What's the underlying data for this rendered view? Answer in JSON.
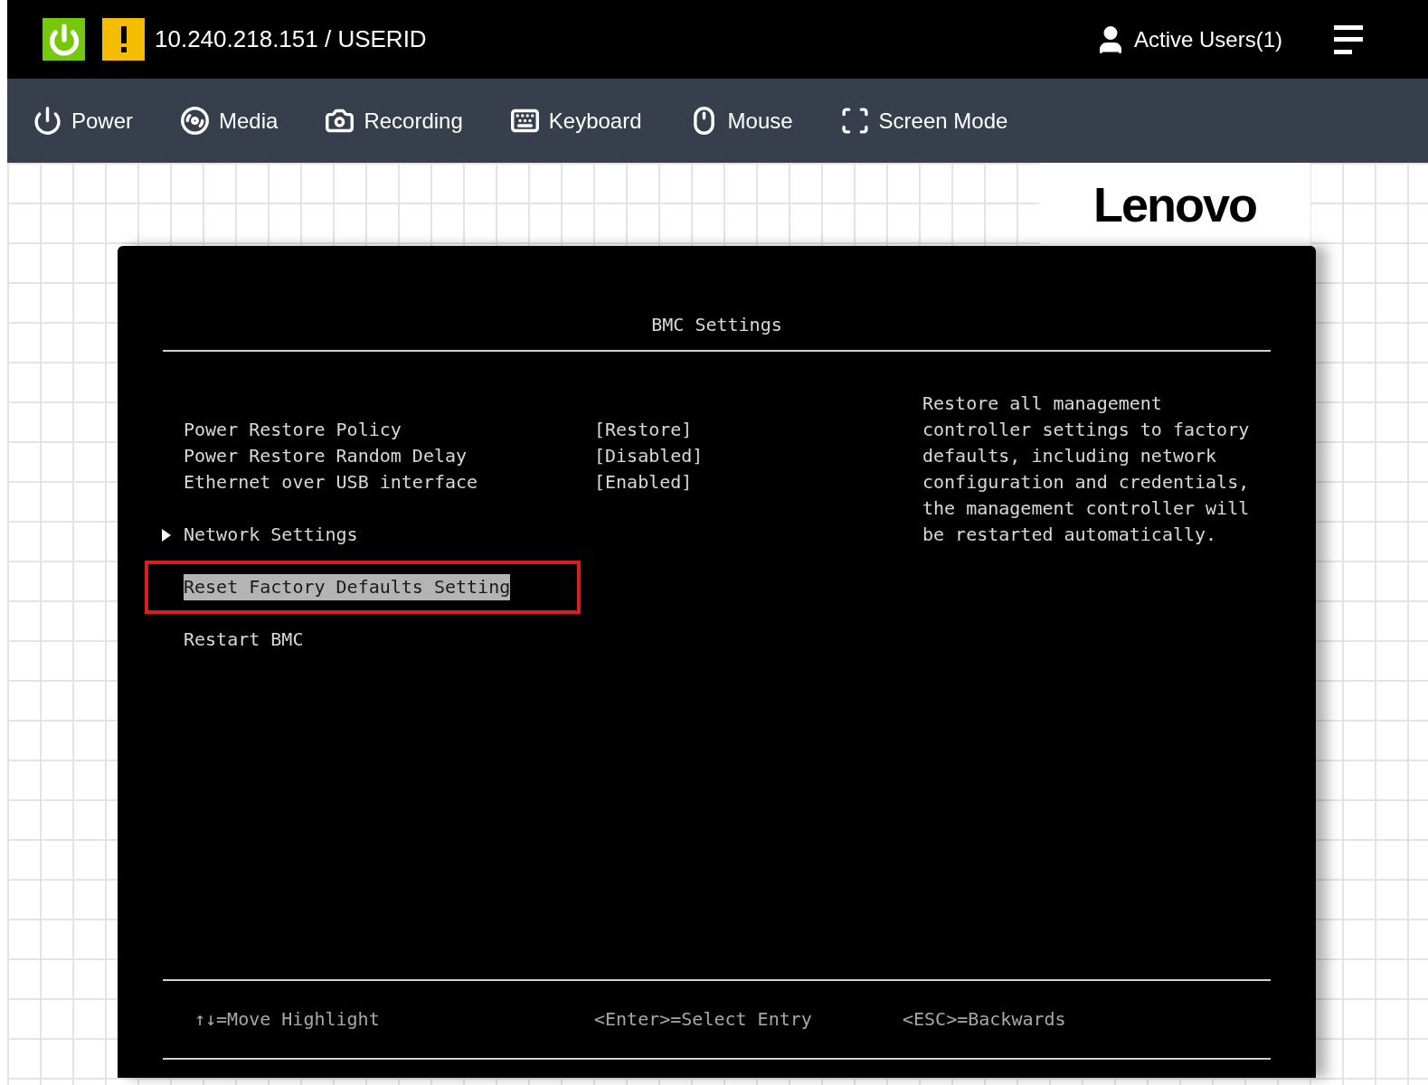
{
  "header": {
    "address": "10.240.218.151 / USERID",
    "active_users": "Active Users(1)"
  },
  "toolbar": [
    {
      "label": "Power",
      "kind": "power"
    },
    {
      "label": "Media",
      "kind": "disc"
    },
    {
      "label": "Recording",
      "kind": "camera"
    },
    {
      "label": "Keyboard",
      "kind": "keyboard"
    },
    {
      "label": "Mouse",
      "kind": "mouse"
    },
    {
      "label": "Screen Mode",
      "kind": "screen"
    }
  ],
  "logo": "Lenovo",
  "console": {
    "title": "BMC Settings",
    "items": [
      {
        "kind": "setting",
        "label": "Power Restore Policy",
        "value": "[Restore]",
        "selected": false,
        "boxed": false
      },
      {
        "kind": "setting",
        "label": "Power Restore Random Delay",
        "value": "[Disabled]",
        "selected": false,
        "boxed": false
      },
      {
        "kind": "setting",
        "label": "Ethernet over USB interface",
        "value": "[Enabled]",
        "selected": false,
        "boxed": false
      },
      {
        "kind": "submenu",
        "label": "Network Settings",
        "selected": false,
        "boxed": false
      },
      {
        "kind": "action",
        "label": "Reset Factory Defaults Setting",
        "selected": true,
        "boxed": true
      },
      {
        "kind": "action",
        "label": "Restart BMC",
        "selected": false,
        "boxed": false
      }
    ],
    "help": [
      "Restore all management",
      "controller settings to factory",
      "defaults, including network",
      "configuration and credentials,",
      "the management controller will",
      "be restarted automatically."
    ],
    "hints": [
      "↑↓=Move Highlight",
      "<Enter>=Select Entry",
      "<ESC>=Backwards"
    ]
  }
}
